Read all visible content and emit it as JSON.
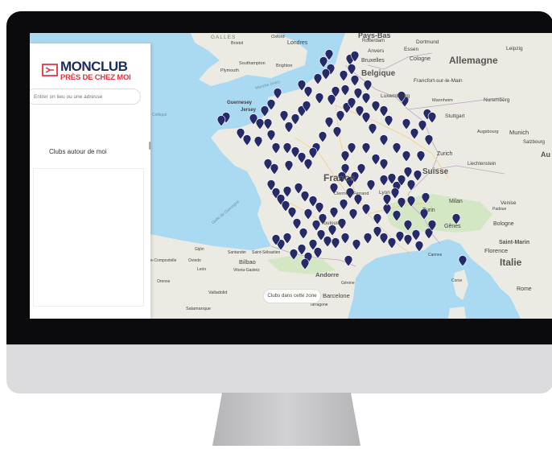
{
  "brand": {
    "line1": "MONCLUB",
    "line2": "PRÈS DE CHEZ MOI"
  },
  "search": {
    "placeholder": "Entrer un lieu ou une adresse"
  },
  "sidebar": {
    "nearby_label": "Clubs autour de moi"
  },
  "map": {
    "zone_button": "Clubs dans cette zone",
    "labels": {
      "pays_bas": "Pays-Bas",
      "rotterdam": "Rotterdam",
      "dortmund": "Dortmund",
      "londres": "Londres",
      "oxford": "Oxford",
      "galles": "GALLES",
      "bristol": "Bristol",
      "anvers": "Anvers",
      "essen": "Essen",
      "bruxelles": "Bruxelles",
      "cologne": "Cologne",
      "allemagne": "Allemagne",
      "leipzig": "Leipzig",
      "plymouth": "Plymouth",
      "southampton": "Southampton",
      "brighton": "Brighton",
      "belgique": "Belgique",
      "manche": "Manche (mer)",
      "frankfurt": "Francfort-sur-le-Main",
      "luxembourg": "Luxembourg",
      "mannheim": "Mannheim",
      "nuremberg": "Nuremberg",
      "guernesey": "Guernesey",
      "jersey": "Jersey",
      "celtique": "Celtique",
      "stuttgart": "Stuttgart",
      "augsbourg": "Augsbourg",
      "munich": "Munich",
      "salzbourg": "Salzbourg",
      "zurich": "Zurich",
      "liechtenstein": "Liechtenstein",
      "suisse": "Suisse",
      "france": "France",
      "clermont": "Clermont-Ferrand",
      "lyon": "Lyon",
      "golfe": "Golfe de Gascogne",
      "milan": "Milan",
      "venise": "Venise",
      "padoue": "Padoue",
      "turin": "Turin",
      "bologne": "Bologne",
      "genes": "Gênes",
      "toulouse": "Toulouse",
      "saint_marin": "Saint-Marin",
      "florence": "Florence",
      "gijon": "Gijón",
      "santander": "Santander",
      "saint_sebastien": "Saint-Sébastien",
      "bilbao": "Bilbao",
      "vitoria": "Vitoria-Gasteiz",
      "compostelle": "e-Compostelle",
      "oviedo": "Oviedo",
      "leon": "León",
      "andorre": "Andorre",
      "cannes": "Cannes",
      "italie": "Italie",
      "girone": "Gérone",
      "barcelone": "Barcelone",
      "tarragone": "Tarragone",
      "valladolid": "Valladolid",
      "salamanque": "Salamanque",
      "corse": "Corse",
      "rome": "Rome",
      "orense": "Orense",
      "au": "Au"
    }
  },
  "colors": {
    "navy": "#1e2a5a",
    "red": "#e3323f",
    "sea": "#aadaf2",
    "land": "#ecebe3",
    "marker": "#262a66"
  }
}
